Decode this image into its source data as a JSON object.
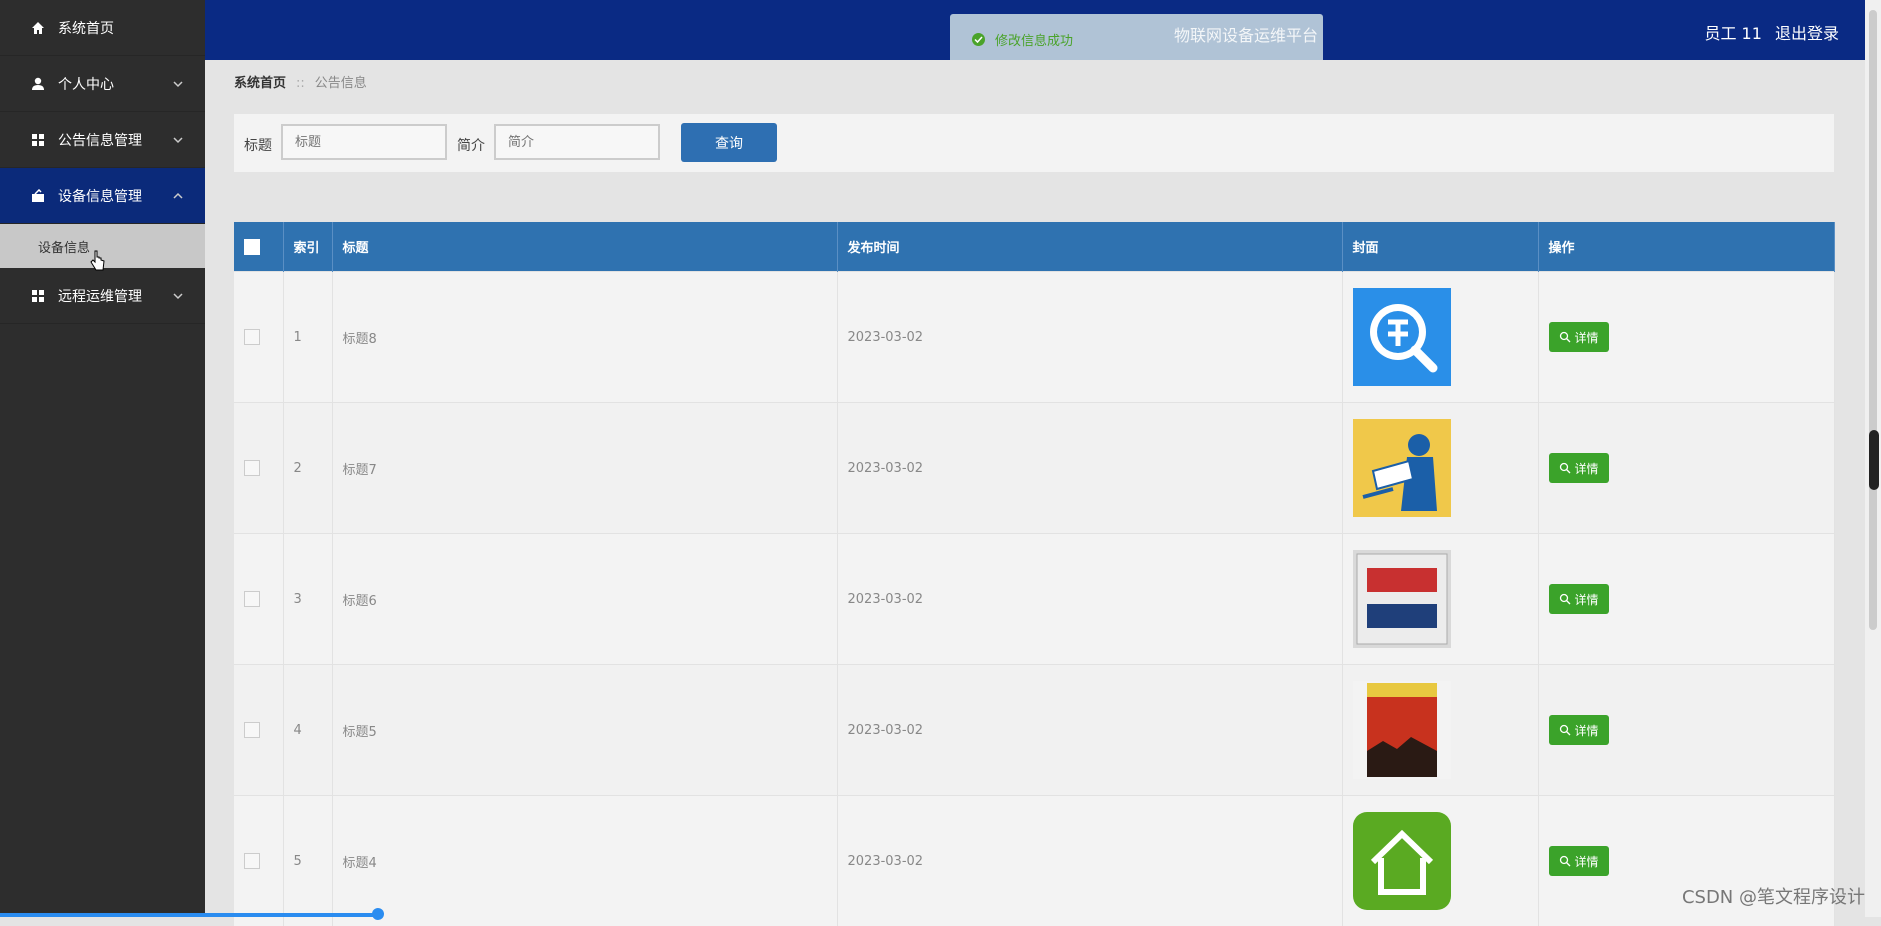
{
  "sidebar": {
    "items": [
      {
        "label": "系统首页",
        "icon": "home-icon"
      },
      {
        "label": "个人中心",
        "icon": "user-icon"
      },
      {
        "label": "公告信息管理",
        "icon": "grid-icon"
      },
      {
        "label": "设备信息管理",
        "icon": "device-icon",
        "expanded": true
      },
      {
        "label": "远程运维管理",
        "icon": "grid-icon"
      }
    ],
    "sub_item": "设备信息"
  },
  "header": {
    "title": "物联网设备运维平台",
    "user": "员工 11",
    "logout": "退出登录",
    "toast": "修改信息成功"
  },
  "breadcrumb": {
    "home": "系统首页",
    "separator": "::",
    "current": "公告信息"
  },
  "search": {
    "title_label": "标题",
    "title_placeholder": "标题",
    "intro_label": "简介",
    "intro_placeholder": "简介",
    "button": "查询"
  },
  "table": {
    "headers": [
      "索引",
      "标题",
      "发布时间",
      "封面",
      "操作"
    ],
    "rows": [
      {
        "index": "1",
        "title": "标题8",
        "date": "2023-03-02",
        "action": "详情"
      },
      {
        "index": "2",
        "title": "标题7",
        "date": "2023-03-02",
        "action": "详情"
      },
      {
        "index": "3",
        "title": "标题6",
        "date": "2023-03-02",
        "action": "详情"
      },
      {
        "index": "4",
        "title": "标题5",
        "date": "2023-03-02",
        "action": "详情"
      },
      {
        "index": "5",
        "title": "标题4",
        "date": "2023-03-02",
        "action": "详情"
      }
    ]
  },
  "watermark": "CSDN @笔文程序设计",
  "colors": {
    "header_bg": "#0a2a84",
    "sidebar_bg": "#2d2d2d",
    "table_header": "#2f72b0",
    "detail_btn": "#3ba32a"
  }
}
